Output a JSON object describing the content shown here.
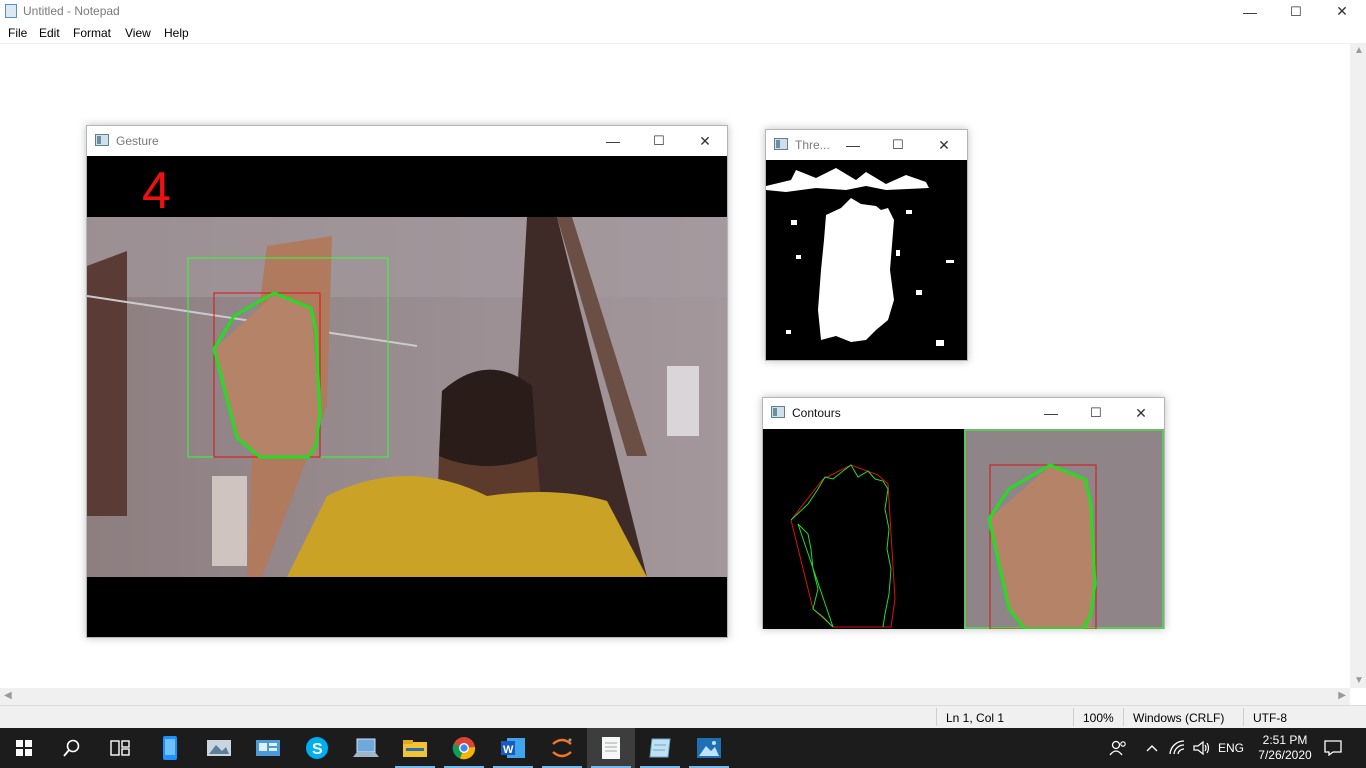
{
  "notepad": {
    "title": "Untitled - Notepad",
    "menu": [
      "File",
      "Edit",
      "Format",
      "View",
      "Help"
    ],
    "status": {
      "position": "Ln 1, Col 1",
      "zoom": "100%",
      "line_ending": "Windows (CRLF)",
      "encoding": "UTF-8"
    }
  },
  "windows": {
    "gesture": {
      "title": "Gesture",
      "count_text": "4"
    },
    "threshold": {
      "title": "Thre..."
    },
    "contours": {
      "title": "Contours"
    }
  },
  "window_controls": {
    "minimize": "—",
    "maximize": "☐",
    "close": "✕"
  },
  "taskbar": {
    "apps": [
      "start-icon",
      "search-icon",
      "task-view-icon",
      "phone-icon",
      "photos-viewer-icon",
      "media-app-icon",
      "skype-icon",
      "pc-icon",
      "file-explorer-icon",
      "chrome-icon",
      "word-icon",
      "jupyter-icon",
      "notepad-icon",
      "notepad-window-icon",
      "photos-icon"
    ],
    "tray": {
      "language": "ENG",
      "time": "2:51 PM",
      "date": "7/26/2020"
    }
  },
  "colors": {
    "accent": "#0078d7",
    "contour_green": "#22dd22",
    "hull_red": "#dd1111",
    "box_green": "#33ff33",
    "taskbar": "#1c1c1c"
  }
}
